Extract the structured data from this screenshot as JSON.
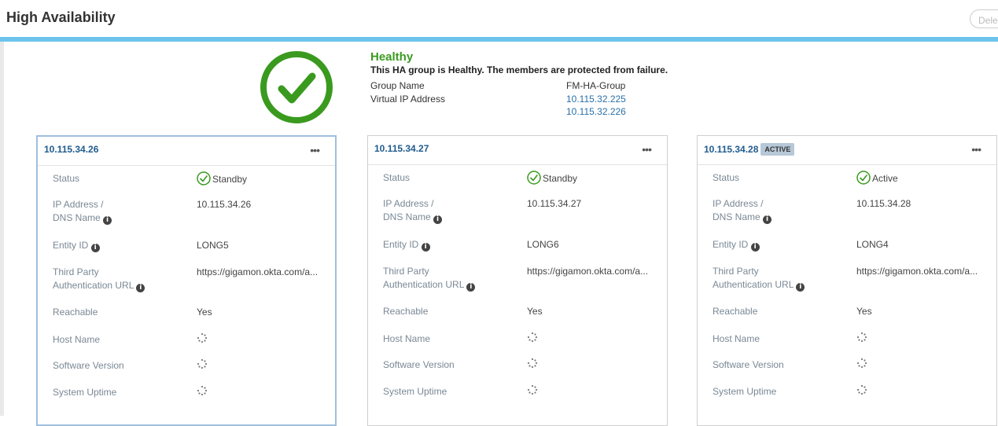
{
  "header": {
    "title": "High Availability",
    "delete_label": "Dele"
  },
  "health": {
    "status": "Healthy",
    "message": "This HA group is Healthy. The members are protected from failure.",
    "group_name_label": "Group Name",
    "group_name": "FM-HA-Group",
    "vip_label": "Virtual IP Address",
    "vips": [
      "10.115.32.225",
      "10.115.32.226"
    ],
    "color": "#3a9a1f"
  },
  "labels": {
    "status": "Status",
    "ip_line1": "IP Address /",
    "ip_line2": "DNS Name",
    "entity": "Entity ID",
    "tp_line1": "Third Party",
    "tp_line2": "Authentication URL",
    "reachable": "Reachable",
    "host": "Host Name",
    "software": "Software Version",
    "uptime": "System Uptime"
  },
  "nodes": [
    {
      "title": "10.115.34.26",
      "badge": "",
      "status": "Standby",
      "ip": "10.115.34.26",
      "entity": "LONG5",
      "auth_url": "https://gigamon.okta.com/a...",
      "reachable": "Yes"
    },
    {
      "title": "10.115.34.27",
      "badge": "",
      "status": "Standby",
      "ip": "10.115.34.27",
      "entity": "LONG6",
      "auth_url": "https://gigamon.okta.com/a...",
      "reachable": "Yes"
    },
    {
      "title": "10.115.34.28",
      "badge": "ACTIVE",
      "status": "Active",
      "ip": "10.115.34.28",
      "entity": "LONG4",
      "auth_url": "https://gigamon.okta.com/a...",
      "reachable": "Yes"
    }
  ],
  "icons": {
    "health": "check-circle-icon",
    "more": "more-horizontal-icon",
    "info": "info-icon",
    "loading": "spinner-icon"
  }
}
